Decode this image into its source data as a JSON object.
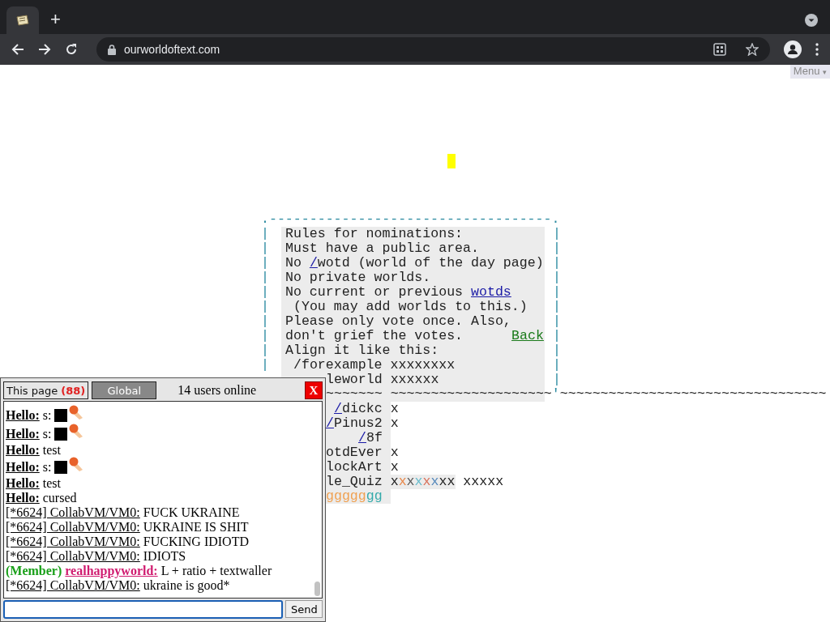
{
  "browser": {
    "new_tab": "+",
    "url": "ourworldoftext.com"
  },
  "menu": {
    "label": "Menu",
    "caret": "▾"
  },
  "world": {
    "lines": [
      {
        "spans": [
          {
            "text": ".-----------------------------------.",
            "kind": "border"
          }
        ]
      },
      {
        "border_left": "|",
        "spans": [
          {
            "text": "Rules for nominations:",
            "kind": "text"
          }
        ],
        "border_right": "|"
      },
      {
        "border_left": "|",
        "spans": [
          {
            "text": "Must have a public area.",
            "kind": "text"
          }
        ],
        "border_right": "|"
      },
      {
        "border_left": "|",
        "spans": [
          {
            "text": "No ",
            "kind": "text"
          },
          {
            "text": "/",
            "kind": "link"
          },
          {
            "text": "wotd (world of the day page)",
            "kind": "text"
          }
        ],
        "border_right": "|"
      },
      {
        "border_left": "|",
        "spans": [
          {
            "text": "No private worlds.",
            "kind": "text"
          }
        ],
        "border_right": "|"
      },
      {
        "border_left": "|",
        "spans": [
          {
            "text": "No current or previous ",
            "kind": "text"
          },
          {
            "text": "wotds",
            "kind": "link"
          }
        ],
        "border_right": "|"
      },
      {
        "border_left": "|",
        "spans": [
          {
            "text": "(You may add worlds to this.)",
            "kind": "text"
          }
        ],
        "border_right": "|"
      },
      {
        "border_left": "|",
        "spans": [
          {
            "text": "Please only vote once. Also,",
            "kind": "text"
          }
        ],
        "border_right": "|"
      },
      {
        "border_left": "|",
        "spans": [
          {
            "text": "don't grief the votes.",
            "kind": "text"
          },
          {
            "text": "Back",
            "kind": "back-link"
          }
        ],
        "border_right": "|"
      },
      {
        "border_left": "|",
        "spans": [
          {
            "text": "Align it like this:",
            "kind": "text"
          }
        ],
        "border_right": "|"
      },
      {
        "border_left": "|",
        "spans": [
          {
            "text": "/forexample xxxxxxxx",
            "kind": "text"
          }
        ],
        "border_right": "|"
      },
      {
        "spans": [
          {
            "text": "leworld xxxxxx",
            "kind": "text"
          }
        ],
        "border_right": "|"
      },
      {
        "spans": [
          {
            "text": "~~~~~~~ ~~~~~~~~~~~~~~~~~~~~",
            "kind": "text"
          },
          {
            "text": "'",
            "kind": "border"
          },
          {
            "text": "~~~~~~~~~~~~~~~~~~~~~~~~~~~~~~~~~",
            "kind": "text"
          }
        ]
      },
      {
        "spans": [
          {
            "text": "/",
            "kind": "link"
          },
          {
            "text": "dickc x",
            "kind": "text"
          }
        ]
      },
      {
        "spans": [
          {
            "text": "/",
            "kind": "link"
          },
          {
            "text": "Pinus2 x",
            "kind": "text"
          }
        ]
      },
      {
        "spans": [
          {
            "text": "/",
            "kind": "link"
          },
          {
            "text": "8f",
            "kind": "text"
          }
        ]
      },
      {
        "spans": [
          {
            "text": "otdEver x",
            "kind": "text"
          }
        ]
      },
      {
        "spans": [
          {
            "text": "lockArt x",
            "kind": "text"
          }
        ]
      },
      {
        "spans": [
          {
            "text": "le_Quiz x",
            "kind": "text"
          },
          {
            "text": "x",
            "kind": "colored",
            "color": "#e8884a"
          },
          {
            "text": "x",
            "kind": "colored",
            "color": "#555555"
          },
          {
            "text": "x",
            "kind": "colored",
            "color": "#66bbcc"
          },
          {
            "text": "x",
            "kind": "colored",
            "color": "#d9705a"
          },
          {
            "text": "x",
            "kind": "colored",
            "color": "#5588bb"
          },
          {
            "text": "xx xxxxx",
            "kind": "text"
          }
        ]
      },
      {
        "spans": [
          {
            "text": "ggggg",
            "kind": "colored",
            "color": "#f0a050"
          },
          {
            "text": "gg",
            "kind": "colored",
            "color": "#33aaaa"
          }
        ]
      }
    ]
  },
  "chat": {
    "tabs": [
      {
        "label": "This page",
        "count": "(88)",
        "selected": true
      },
      {
        "label": "Global",
        "selected": false
      }
    ],
    "online": "14 users online",
    "close": "X",
    "messages": [
      {
        "kind": "hello",
        "name": "Hello:",
        "text": "s:",
        "emotes": true
      },
      {
        "kind": "hello",
        "name": "Hello:",
        "text": "s:",
        "emotes": true
      },
      {
        "kind": "hello",
        "name": "Hello:",
        "text": "test",
        "emotes": false
      },
      {
        "kind": "hello",
        "name": "Hello:",
        "text": "s:",
        "emotes": true
      },
      {
        "kind": "hello",
        "name": "Hello:",
        "text": "test",
        "emotes": false
      },
      {
        "kind": "hello",
        "name": "Hello:",
        "text": "cursed",
        "emotes": false
      },
      {
        "kind": "user",
        "name": "[*6624] CollabVM/VM0:",
        "text": "FUCK UKRAINE",
        "emotes": false
      },
      {
        "kind": "user",
        "name": "[*6624] CollabVM/VM0:",
        "text": "UKRAINE IS SHIT",
        "emotes": false
      },
      {
        "kind": "user",
        "name": "[*6624] CollabVM/VM0:",
        "text": "FUCKING IDIOTD",
        "emotes": false
      },
      {
        "kind": "user",
        "name": "[*6624] CollabVM/VM0:",
        "text": "IDIOTS",
        "emotes": false
      },
      {
        "kind": "member",
        "badge": "(Member)",
        "name": "realhappyworld:",
        "text": "L + ratio + textwaller",
        "emotes": false
      },
      {
        "kind": "user",
        "name": "[*6624] CollabVM/VM0:",
        "text": "ukraine is good*",
        "emotes": false
      }
    ],
    "send": "Send"
  }
}
